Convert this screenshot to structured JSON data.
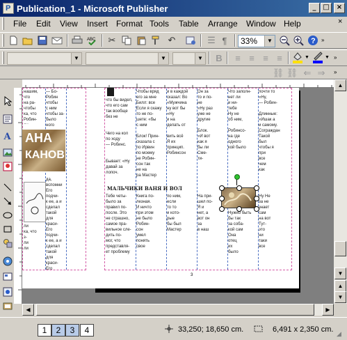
{
  "window": {
    "title": "Publication_1 - Microsoft Publisher"
  },
  "menu": [
    "File",
    "Edit",
    "View",
    "Insert",
    "Format",
    "Tools",
    "Table",
    "Arrange",
    "Window",
    "Help"
  ],
  "toolbar": {
    "zoom": "33%"
  },
  "document": {
    "headline": "МАЛЬЧИКИ ВАНЯ И ВОЛ",
    "banner_line1": "АНА",
    "banner_line2": "КАНОВ",
    "page_number": "3"
  },
  "status": {
    "pages": [
      "1",
      "2",
      "3",
      "4"
    ],
    "position": "33,250; 18,650 cm.",
    "size": "6,491 x  2,350 cm."
  },
  "colors": {
    "title_bar": "#0a246a",
    "page_tab": "#b8cbe8",
    "margin_guide": "#d45aa6",
    "column_guide": "#4a6ec2",
    "fill_swatch": "#ffe000",
    "line_swatch": "#0000ff"
  }
}
